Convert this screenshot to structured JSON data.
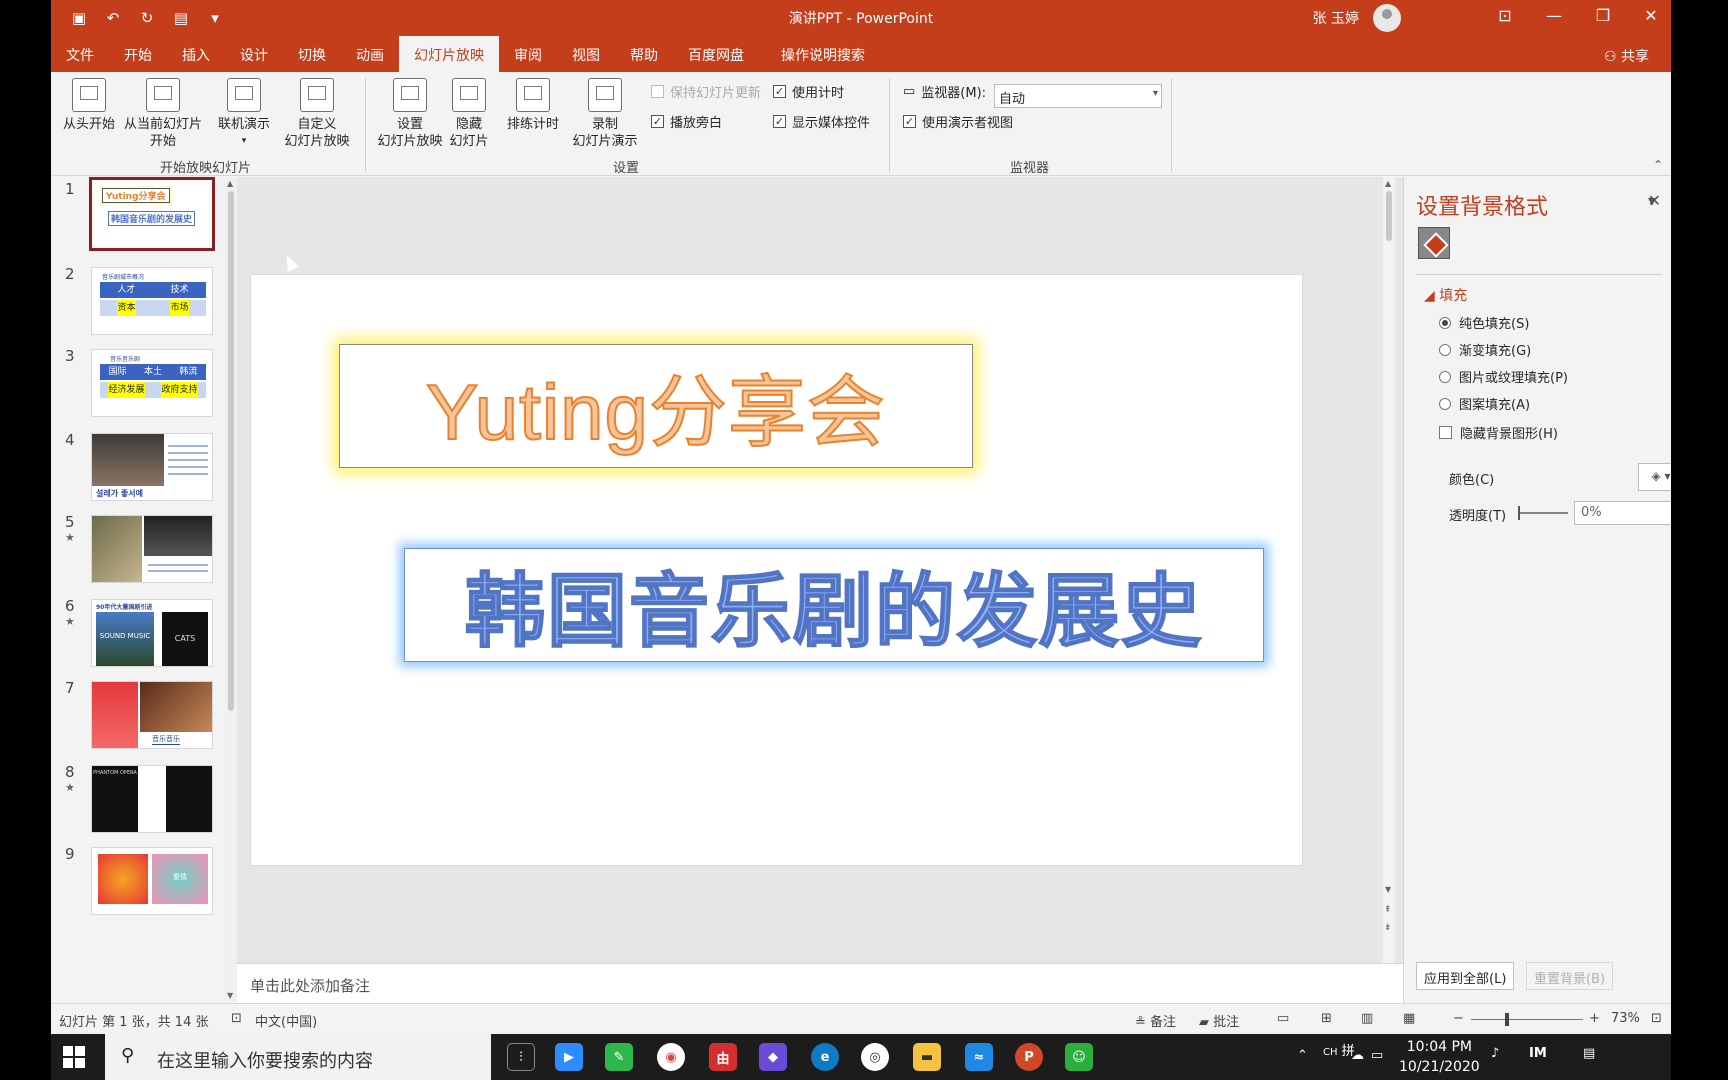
{
  "window": {
    "doc_title": "演讲PPT  -  PowerPoint",
    "user_name": "张 玉婷",
    "min_label": "—",
    "restore_label": "❐",
    "close_label": "✕",
    "ribbon_display_label": "⊡"
  },
  "menu": {
    "tabs": [
      "文件",
      "开始",
      "插入",
      "设计",
      "切换",
      "动画",
      "幻灯片放映",
      "审阅",
      "视图",
      "帮助",
      "百度网盘",
      "操作说明搜索"
    ],
    "active_tab": "幻灯片放映",
    "share_label": "共享"
  },
  "ribbon": {
    "from_start": "从头开始",
    "from_current_1": "从当前幻灯片",
    "from_current_2": "开始",
    "online_present": "联机演示",
    "custom_1": "自定义",
    "custom_2": "幻灯片放映",
    "group_start": "开始放映幻灯片",
    "setup_1": "设置",
    "setup_2": "幻灯片放映",
    "hide_1": "隐藏",
    "hide_2": "幻灯片",
    "rehearse": "排练计时",
    "record_1": "录制",
    "record_2": "幻灯片演示",
    "keep_updated": "保持幻灯片更新",
    "play_narration": "播放旁白",
    "use_timings": "使用计时",
    "show_media": "显示媒体控件",
    "group_setup": "设置",
    "monitor_label": "监视器(M):",
    "monitor_value": "自动",
    "presenter_view": "使用演示者视图",
    "group_monitor": "监视器"
  },
  "thumbnails": [
    {
      "num": "1",
      "starred": false
    },
    {
      "num": "2",
      "starred": false
    },
    {
      "num": "3",
      "starred": false
    },
    {
      "num": "4",
      "starred": false
    },
    {
      "num": "5",
      "starred": true
    },
    {
      "num": "6",
      "starred": true
    },
    {
      "num": "7",
      "starred": false
    },
    {
      "num": "8",
      "starred": true
    },
    {
      "num": "9",
      "starred": false
    }
  ],
  "thumb_text": {
    "t1_title": "Yuting分享会",
    "t1_sub": "韩国音乐剧的发展史",
    "t2_head": "音乐剧城市概况",
    "t2_c1": "人才",
    "t2_c2": "技术",
    "t2_c3": "资本",
    "t2_c4": "市场",
    "t3_head": "音乐音乐剧",
    "t3_c1": "国际",
    "t3_c2": "本土",
    "t3_c3": "韩流",
    "t3_c4": "经济发展",
    "t3_c5": "政府支持",
    "t4_caption": "설레가 좋서예",
    "t6_head": "90年代大量国剧引进",
    "t6_left": "SOUND MUSIC",
    "t6_right": "CATS",
    "t7_caption": "音乐音乐",
    "t8_left": "PHANTOM OPERA",
    "t9_label": "爱情",
    "star": "★"
  },
  "slide": {
    "title": "Yuting分享会",
    "subtitle": "韩国音乐剧的发展史"
  },
  "notes_placeholder": "单击此处添加备注",
  "panel": {
    "title": "设置背景格式",
    "section": "填充",
    "options": [
      "纯色填充(S)",
      "渐变填充(G)",
      "图片或纹理填充(P)",
      "图案填充(A)"
    ],
    "selected_option": "纯色填充(S)",
    "hide_bg": "隐藏背景图形(H)",
    "color_label": "颜色(C)",
    "transparency_label": "透明度(T)",
    "transparency_value": "0%",
    "apply_all": "应用到全部(L)",
    "reset": "重置背景(B)"
  },
  "status": {
    "slide_info": "幻灯片 第 1 张，共 14 张",
    "language": "中文(中国)",
    "notes": "备注",
    "comments": "批注",
    "zoom": "73%"
  },
  "taskbar": {
    "search_placeholder": "在这里输入你要搜索的内容",
    "time": "10:04 PM",
    "date": "10/21/2020",
    "ime": "CH",
    "ime2": "拼"
  },
  "colors": {
    "accent": "#c43e1c",
    "title_fill": "#f6c49a",
    "title_stroke": "#e9822c",
    "subtitle_fill": "#8eaef0",
    "subtitle_stroke": "#5175c4"
  }
}
